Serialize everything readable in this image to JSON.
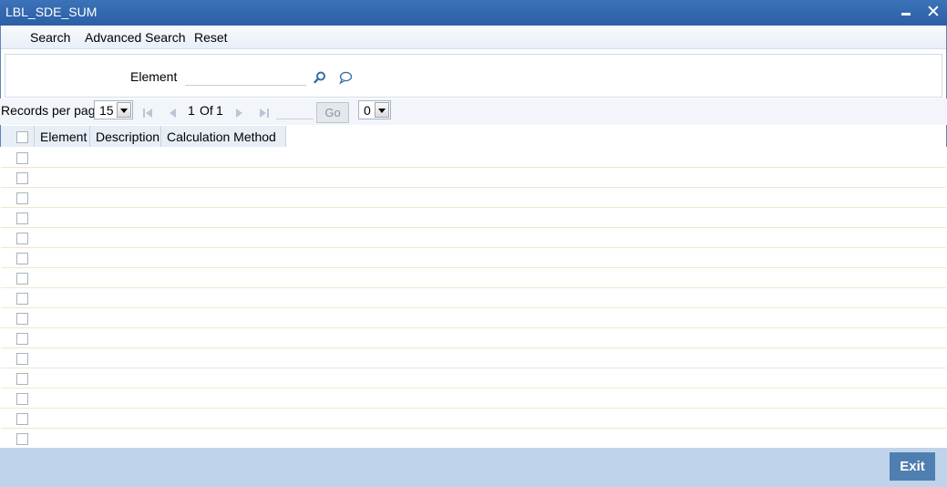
{
  "window": {
    "title": "LBL_SDE_SUM"
  },
  "toolbar": {
    "search": "Search",
    "advanced_search": "Advanced Search",
    "reset": "Reset"
  },
  "criteria": {
    "element_label": "Element",
    "element_value": ""
  },
  "pager": {
    "records_label": "Records per page",
    "records_value": "15",
    "current_page": "1",
    "of_label": "Of",
    "total_pages": "1",
    "go_label": "Go",
    "extra_select_value": "0"
  },
  "grid": {
    "columns": [
      "Element",
      "Description",
      "Calculation Method"
    ],
    "row_count": 15
  },
  "footer": {
    "exit_label": "Exit"
  },
  "colors": {
    "titlebar": "#2b5ea6",
    "footer": "#bfd4ea",
    "exit_button": "#4f7fb0"
  }
}
